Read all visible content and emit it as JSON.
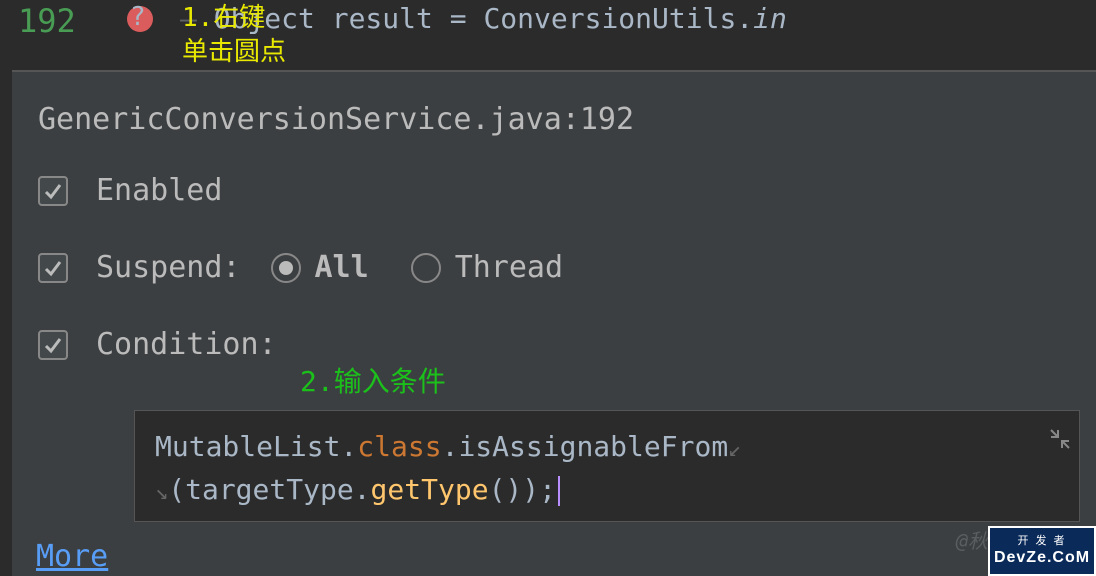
{
  "editor": {
    "line_number": "192",
    "code_prefix_dash": "— ",
    "code_object": "Object result = ConversionUtils.",
    "code_invoke": "in"
  },
  "annotations": {
    "note1_line1": "1.右键",
    "note1_line2": "单击圆点",
    "note2": "2.输入条件"
  },
  "popup": {
    "title": "GenericConversionService.java:192",
    "enabled_label": "Enabled",
    "suspend_label": "Suspend:",
    "radio_all": "All",
    "radio_thread": "Thread",
    "condition_label": "Condition:",
    "condition_code_1a": "MutableList.",
    "condition_code_1b": "class",
    "condition_code_1c": ".isAssignableFrom",
    "condition_code_2a": "(targetType.",
    "condition_code_2b": "getType",
    "condition_code_2c": "());",
    "more_link": "More"
  },
  "watermark": {
    "handle": "@秋",
    "logo_top": "开 发 者",
    "logo_bottom": "DevZe.CoM"
  }
}
